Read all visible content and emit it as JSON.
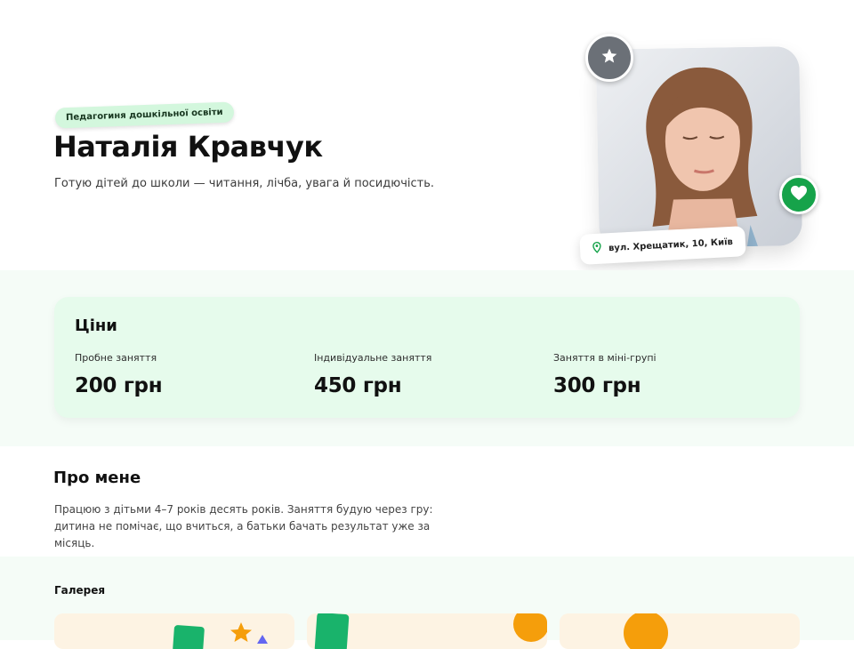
{
  "profile": {
    "badge": "Педагогиня дошкільної освіти",
    "name": "Наталія Кравчук",
    "tagline": "Готую дітей до школи — читання, лічба, увага й посидючість.",
    "address": "вул. Хрещатик, 10, Київ"
  },
  "prices": {
    "title": "Ціни",
    "items": [
      {
        "label": "Пробне заняття",
        "value": "200 грн"
      },
      {
        "label": "Індивідуальне заняття",
        "value": "450 грн"
      },
      {
        "label": "Заняття в міні-групі",
        "value": "300 грн"
      }
    ]
  },
  "about": {
    "title": "Про мене",
    "text": "Працюю з дітьми 4–7 років десять років. Заняття будую через гру: дитина не помічає, що вчиться, а батьки бачать результат уже за місяць."
  },
  "gallery": {
    "title": "Галерея"
  },
  "colors": {
    "accent": "#16a34a",
    "badge_bg": "#d3f7dd",
    "section_bg": "#f5fcf7",
    "card_bg": "#e6fbec"
  },
  "icons": {
    "top_badge": "star-icon",
    "side_badge": "heart-icon",
    "address": "map-pin-icon"
  }
}
